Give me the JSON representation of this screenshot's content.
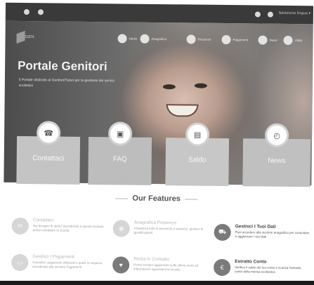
{
  "topbar": {
    "language": "Seleziona lingua ▾"
  },
  "brand": {
    "logo_text": "GEN"
  },
  "nav": [
    {
      "label": "Home",
      "icon": "home-icon"
    },
    {
      "label": "Anagrafica",
      "icon": "user-icon"
    },
    {
      "label": "Presenze",
      "icon": "calendar-icon"
    },
    {
      "label": "Pagamenti",
      "icon": "payment-icon"
    },
    {
      "label": "News",
      "icon": "news-icon"
    },
    {
      "label": "Utility",
      "icon": "utility-icon"
    }
  ],
  "hero": {
    "title": "Portale Genitori",
    "subtitle": "Il Portale dedicato ai Genitori/Tutori per la gestione dei servizi scolastici"
  },
  "tiles": [
    {
      "label": "Contattaci",
      "icon": "contact-icon",
      "glyph": "☎"
    },
    {
      "label": "FAQ",
      "icon": "faq-icon",
      "glyph": "▣"
    },
    {
      "label": "Saldo",
      "icon": "wallet-icon",
      "glyph": "▤"
    },
    {
      "label": "News",
      "icon": "news-icon",
      "glyph": "◴"
    }
  ],
  "features": {
    "heading": "Our Features",
    "items": [
      {
        "title": "Contattaci",
        "desc": "Hai bisogno di aiuto? Accedendo a questa sezione potrai contattare la scuola",
        "active": false,
        "glyph": "✉"
      },
      {
        "title": "Anagrafica Presenze",
        "desc": "Visualizza tutte le presenze e assenze, gestisci le giustificazioni",
        "active": false,
        "glyph": "◉"
      },
      {
        "title": "Gestisci I Tuoi Dati",
        "desc": "Puoi accedere alla sezione anagrafica per consultare e aggiornare i tuoi dati",
        "active": true,
        "glyph": "⛟"
      },
      {
        "title": "Gestisci I Pagamenti",
        "desc": "Consulta i pagamenti effettuati e quelli in sospeso accedendo alla sezione Pagamenti",
        "active": false,
        "glyph": "▭"
      },
      {
        "title": "Resta In Contatto",
        "desc": "Potrai sempre aggiornarti sulle ultime news ed informazioni riguardanti la scuola",
        "active": false,
        "glyph": "♥"
      },
      {
        "title": "Estratto Conto",
        "desc": "Verifica il saldo del tuo conto e scarica l'estratto conto della mensa scolastica",
        "active": true,
        "glyph": "€"
      }
    ]
  }
}
